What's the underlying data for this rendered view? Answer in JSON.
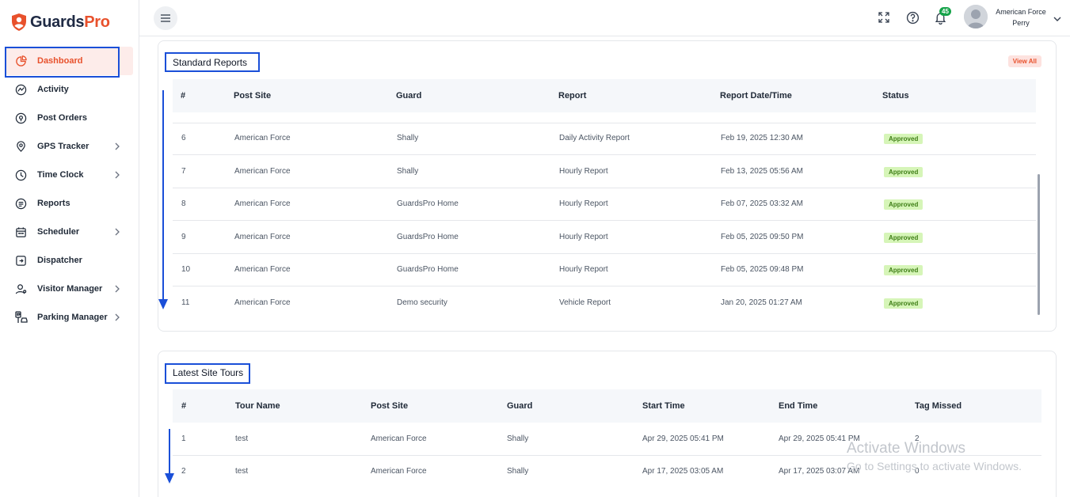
{
  "brand": {
    "part1": "Guards",
    "part2": "Pro",
    "accent": "#e8512c"
  },
  "sidebar": {
    "items": [
      {
        "label": "Dashboard",
        "icon": "pie-chart-icon",
        "active": true,
        "chevron": false
      },
      {
        "label": "Activity",
        "icon": "activity-icon",
        "chevron": false
      },
      {
        "label": "Post Orders",
        "icon": "location-pin-icon",
        "chevron": false
      },
      {
        "label": "GPS Tracker",
        "icon": "map-pin-icon",
        "chevron": true
      },
      {
        "label": "Time Clock",
        "icon": "clock-icon",
        "chevron": true
      },
      {
        "label": "Reports",
        "icon": "report-icon",
        "chevron": false
      },
      {
        "label": "Scheduler",
        "icon": "calendar-icon",
        "chevron": true
      },
      {
        "label": "Dispatcher",
        "icon": "dispatch-icon",
        "chevron": false
      },
      {
        "label": "Visitor Manager",
        "icon": "visitor-icon",
        "chevron": true
      },
      {
        "label": "Parking Manager",
        "icon": "parking-icon",
        "chevron": true
      }
    ]
  },
  "header": {
    "notification_count": "45",
    "user_line1": "American Force",
    "user_line2": "Perry"
  },
  "standard_reports": {
    "title": "Standard Reports",
    "view_all": "View All",
    "columns": [
      "#",
      "Post Site",
      "Guard",
      "Report",
      "Report Date/Time",
      "Status"
    ],
    "rows": [
      {
        "n": "6",
        "site": "American Force",
        "guard": "Shally",
        "report": "Daily Activity Report",
        "date": "Feb 19, 2025 12:30 AM",
        "status": "Approved"
      },
      {
        "n": "7",
        "site": "American Force",
        "guard": "Shally",
        "report": "Hourly Report",
        "date": "Feb 13, 2025 05:56 AM",
        "status": "Approved"
      },
      {
        "n": "8",
        "site": "American Force",
        "guard": "GuardsPro Home",
        "report": "Hourly Report",
        "date": "Feb 07, 2025 03:32 AM",
        "status": "Approved"
      },
      {
        "n": "9",
        "site": "American Force",
        "guard": "GuardsPro Home",
        "report": "Hourly Report",
        "date": "Feb 05, 2025 09:50 PM",
        "status": "Approved"
      },
      {
        "n": "10",
        "site": "American Force",
        "guard": "GuardsPro Home",
        "report": "Hourly Report",
        "date": "Feb 05, 2025 09:48 PM",
        "status": "Approved"
      },
      {
        "n": "11",
        "site": "American Force",
        "guard": "Demo security",
        "report": "Vehicle Report",
        "date": "Jan 20, 2025 01:27 AM",
        "status": "Approved"
      }
    ]
  },
  "site_tours": {
    "title": "Latest Site Tours",
    "columns": [
      "#",
      "Tour Name",
      "Post Site",
      "Guard",
      "Start Time",
      "End Time",
      "Tag Missed"
    ],
    "rows": [
      {
        "n": "1",
        "name": "test",
        "site": "American Force",
        "guard": "Shally",
        "start": "Apr 29, 2025 05:41 PM",
        "end": "Apr 29, 2025 05:41 PM",
        "missed": "2"
      },
      {
        "n": "2",
        "name": "test",
        "site": "American Force",
        "guard": "Shally",
        "start": "Apr 17, 2025 03:05 AM",
        "end": "Apr 17, 2025 03:07 AM",
        "missed": "0"
      }
    ]
  },
  "watermark": {
    "line1": "Activate Windows",
    "line2": "Go to Settings to activate Windows."
  }
}
